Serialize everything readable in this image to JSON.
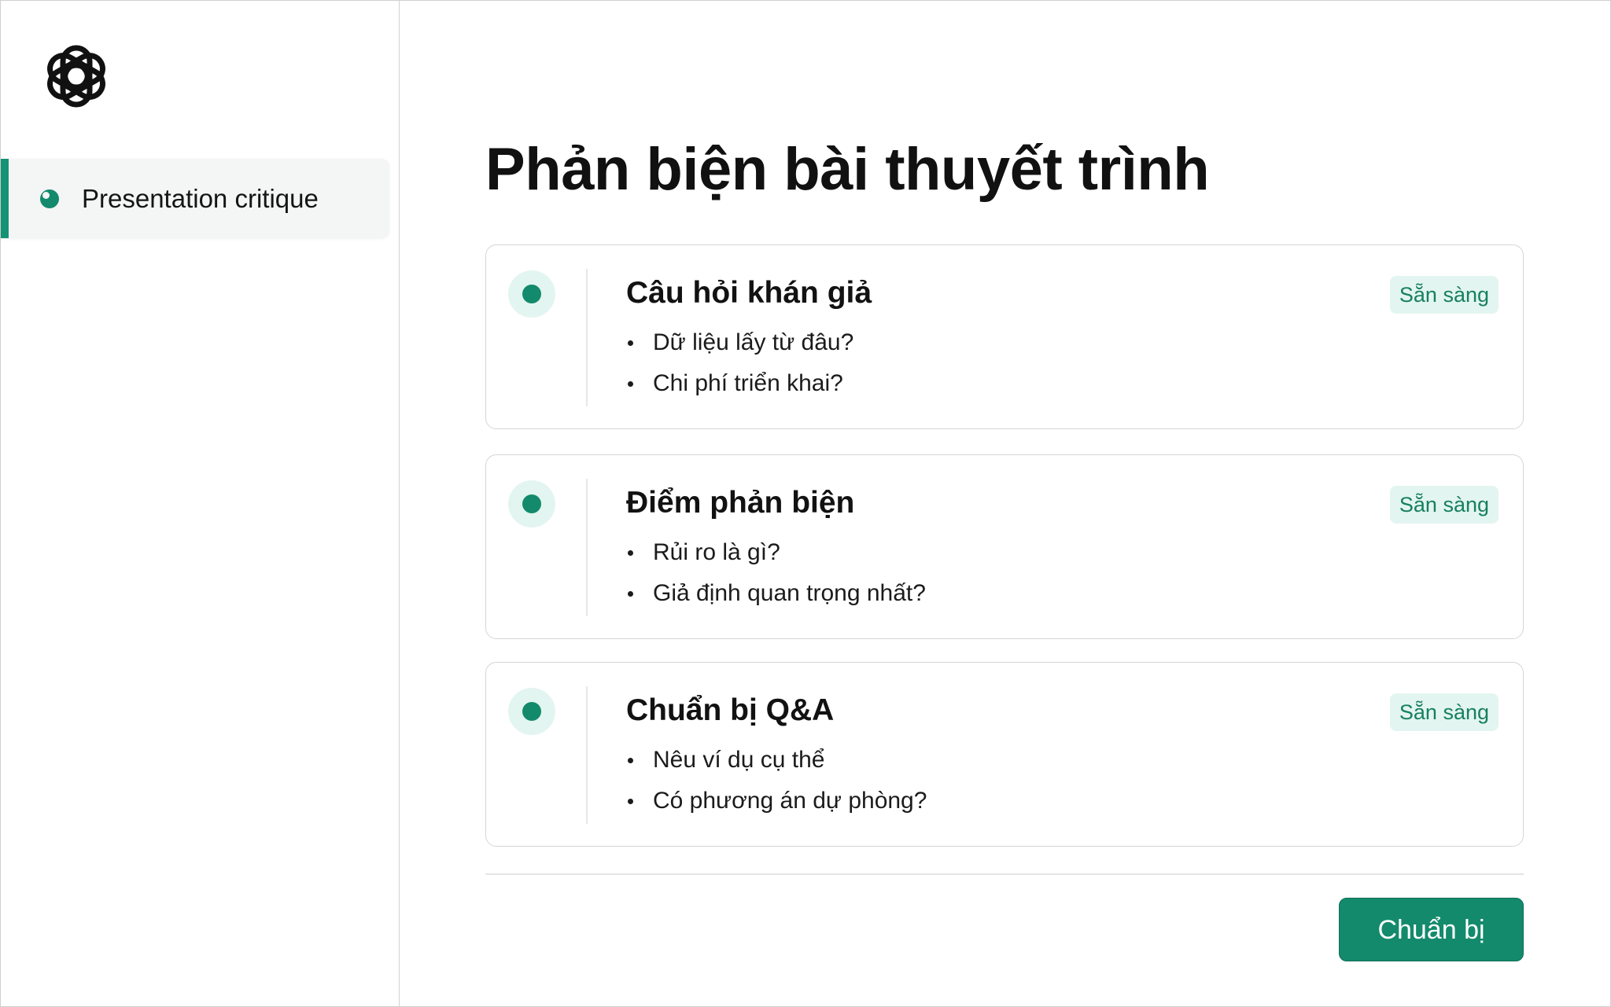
{
  "colors": {
    "accent": "#138a6c",
    "accent_light": "#e3f5f0",
    "badge_text": "#17805f"
  },
  "sidebar": {
    "logo_icon": "openai-logo-icon",
    "items": [
      {
        "label": "Presentation critique",
        "icon": "status-dot-icon",
        "active": true
      }
    ]
  },
  "main": {
    "title": "Phản biện bài thuyết trình",
    "cards": [
      {
        "title": "Câu hỏi khán giả",
        "status": "Sẵn sàng",
        "items": [
          "Dữ liệu lấy từ đâu?",
          "Chi phí triển khai?"
        ]
      },
      {
        "title": "Điểm phản biện",
        "status": "Sẵn sàng",
        "items": [
          "Rủi ro là gì?",
          "Giả định quan trọng nhất?"
        ]
      },
      {
        "title": "Chuẩn bị Q&A",
        "status": "Sẵn sàng",
        "items": [
          "Nêu ví dụ cụ thể",
          "Có phương án dự phòng?"
        ]
      }
    ],
    "primary_button": "Chuẩn bị"
  }
}
